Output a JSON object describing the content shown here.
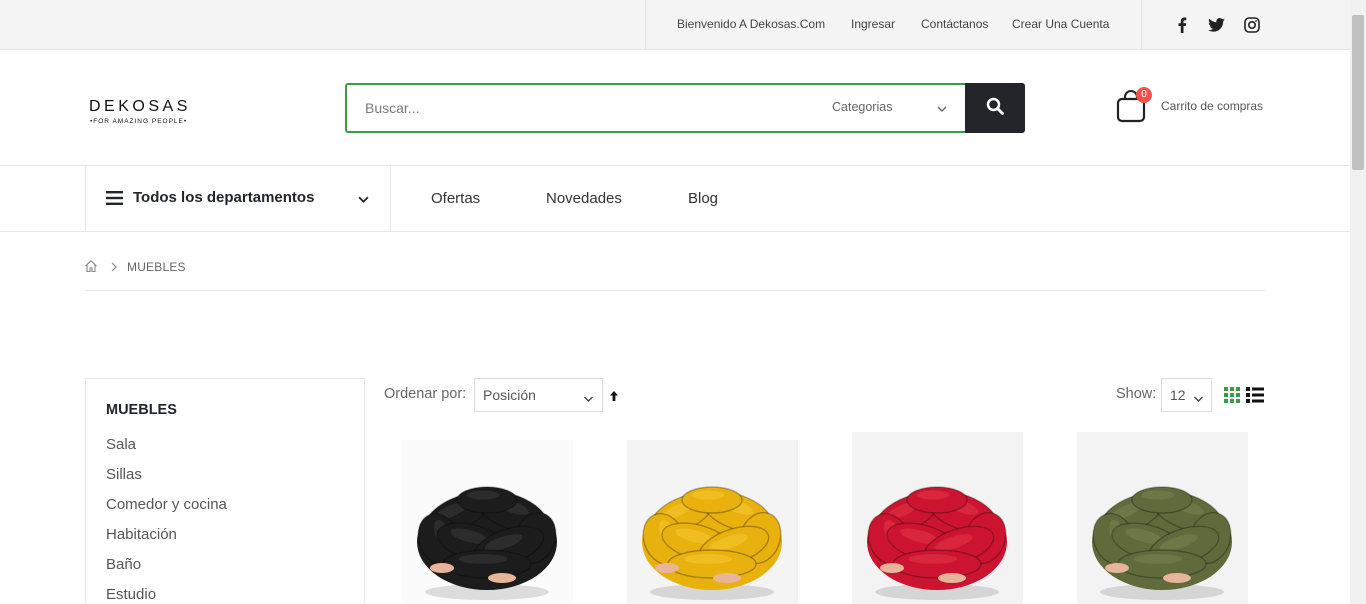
{
  "topbar": {
    "welcome": "Bienvenido A Dekosas.Com",
    "login": "Ingresar",
    "contact": "Contáctanos",
    "register": "Crear Una Cuenta",
    "social_icons": [
      "facebook-icon",
      "twitter-icon",
      "instagram-icon"
    ]
  },
  "header": {
    "logo_word": "DEKOSAS",
    "logo_tagline": "•FOR AMAZING PEOPLE•",
    "search_placeholder": "Buscar...",
    "category_select": "Categorias",
    "cart_count": "0",
    "cart_label": "Carrito de compras"
  },
  "nav": {
    "departments": "Todos los departamentos",
    "items": [
      "Ofertas",
      "Novedades",
      "Blog"
    ]
  },
  "breadcrumb": {
    "current": "MUEBLES"
  },
  "sidebar": {
    "title": "MUEBLES",
    "items": [
      "Sala",
      "Sillas",
      "Comedor y cocina",
      "Habitación",
      "Baño",
      "Estudio"
    ]
  },
  "toolbar": {
    "sort_label": "Ordenar por:",
    "sort_value": "Posición",
    "show_label": "Show:",
    "show_value": "12"
  },
  "products": [
    {
      "color_name": "black",
      "color": "#1c1c1c",
      "hi": "#3a3a3a",
      "bg": "#fbfbfb"
    },
    {
      "color_name": "yellow",
      "color": "#e8b10d",
      "hi": "#f6c935",
      "bg": "#f4f4f4"
    },
    {
      "color_name": "red",
      "color": "#cc1430",
      "hi": "#e23449",
      "bg": "#f3f3f3"
    },
    {
      "color_name": "olive",
      "color": "#5f6b3b",
      "hi": "#77844f",
      "bg": "#f3f3f3"
    }
  ],
  "colors": {
    "accent_green": "#3d9a47",
    "dark": "#222529",
    "badge_red": "#ef5350"
  }
}
